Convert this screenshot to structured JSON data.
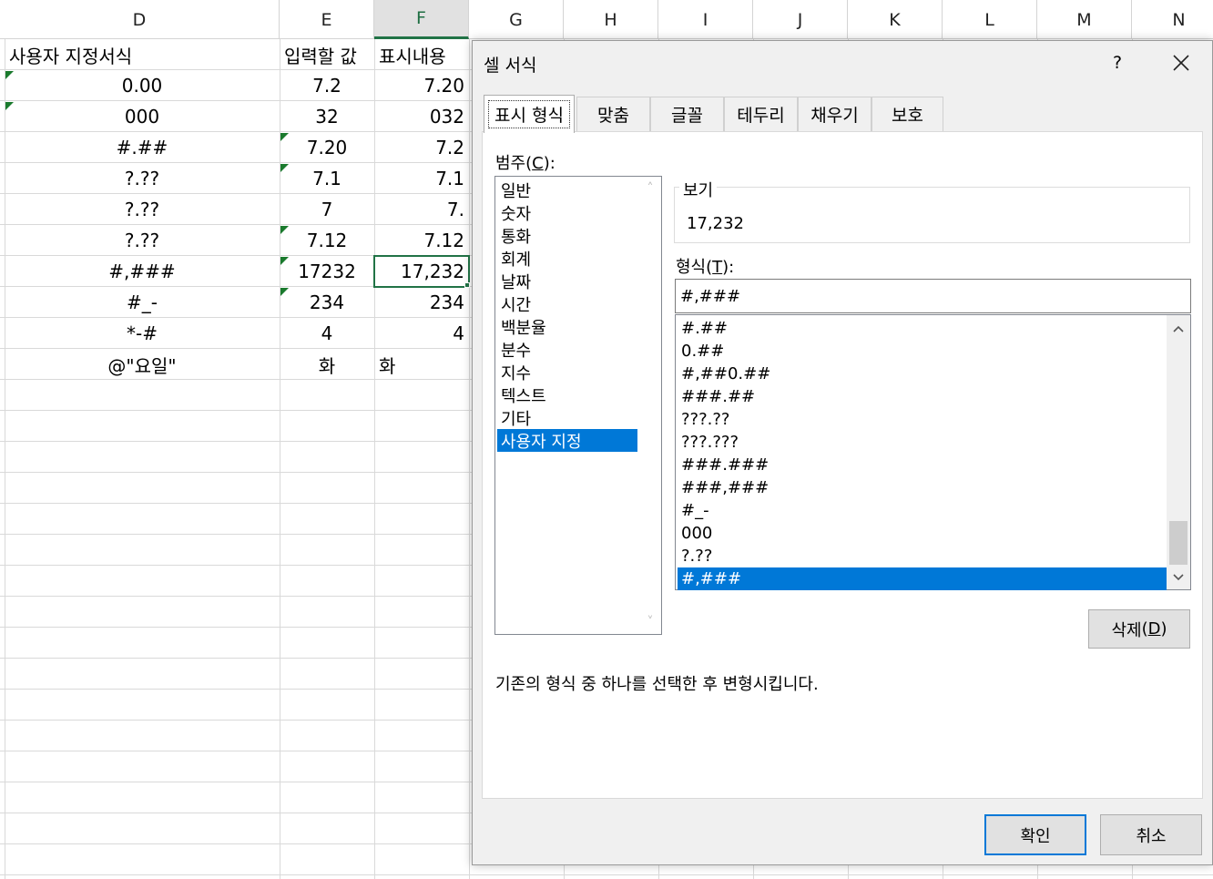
{
  "sheet": {
    "columns": [
      "D",
      "E",
      "F",
      "G",
      "H",
      "I",
      "J",
      "K",
      "L",
      "M",
      "N"
    ],
    "headers": {
      "d": "사용자 지정서식",
      "e": "입력할 값",
      "f": "표시내용"
    },
    "rows": [
      {
        "d": "0.00",
        "e": "7.2",
        "f": "7.20"
      },
      {
        "d": "000",
        "e": "32",
        "f": "032"
      },
      {
        "d": "#.##",
        "e": "7.20",
        "f": "7.2"
      },
      {
        "d": "?.??",
        "e": "7.1",
        "f": "7.1"
      },
      {
        "d": "?.??",
        "e": "7",
        "f": "7."
      },
      {
        "d": "?.??",
        "e": "7.12",
        "f": "7.12"
      },
      {
        "d": "#,###",
        "e": "17232",
        "f": "17,232"
      },
      {
        "d": "#_-",
        "e": "234",
        "f": "234"
      },
      {
        "d": "*-#",
        "e": "4",
        "f": "4"
      },
      {
        "d": "@\"요일\"",
        "e": "화",
        "f": "화"
      }
    ],
    "selected_column": "F",
    "accent_color": "#217346"
  },
  "dialog": {
    "title": "셀 서식",
    "help_label": "?",
    "close_icon": "close-icon",
    "tabs": [
      "표시 형식",
      "맞춤",
      "글꼴",
      "테두리",
      "채우기",
      "보호"
    ],
    "active_tab": "표시 형식",
    "category": {
      "label": "범주",
      "hotkey": "C",
      "items": [
        "일반",
        "숫자",
        "통화",
        "회계",
        "날짜",
        "시간",
        "백분율",
        "분수",
        "지수",
        "텍스트",
        "기타",
        "사용자 지정"
      ],
      "selected": "사용자 지정"
    },
    "preview": {
      "label": "보기",
      "value": "17,232"
    },
    "format": {
      "label": "형식",
      "hotkey": "T",
      "value": "#,###",
      "items": [
        "#.##",
        "0.##",
        "#,##0.##",
        "###.##",
        "???.??",
        "???.???",
        "###.###",
        "###,###",
        "#_-",
        "000",
        "?.??",
        "#,###"
      ],
      "selected": "#,###"
    },
    "delete_button": {
      "label": "삭제",
      "hotkey": "D"
    },
    "description": "기존의 형식 중 하나를 선택한 후 변형시킵니다.",
    "ok_label": "확인",
    "cancel_label": "취소",
    "selection_color": "#0078d7"
  }
}
